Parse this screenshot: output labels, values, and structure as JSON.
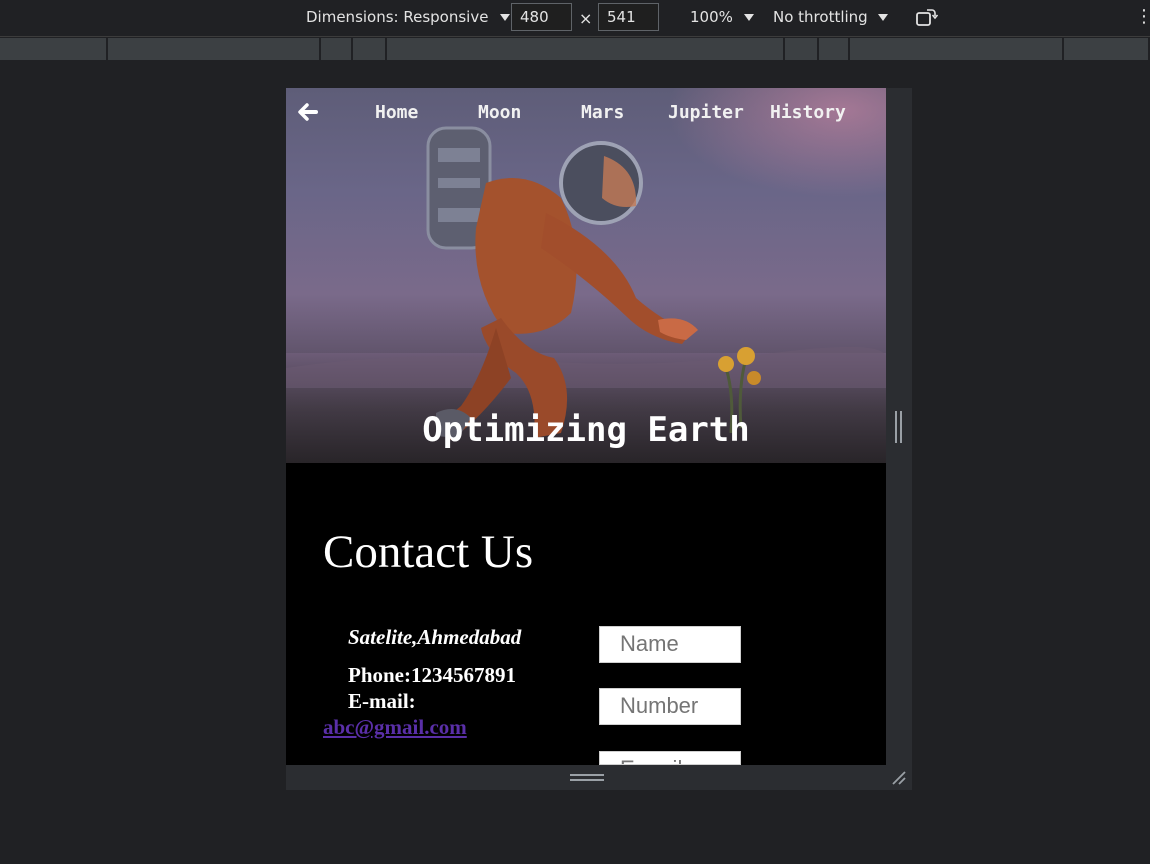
{
  "devtools": {
    "dimensions_label": "Dimensions: Responsive",
    "width_value": "480",
    "height_value": "541",
    "times": "×",
    "zoom": "100%",
    "throttling": "No throttling",
    "more": "⋮"
  },
  "nav": {
    "links": [
      "Home",
      "Moon",
      "Mars",
      "Jupiter",
      "History"
    ]
  },
  "hero": {
    "title": "Optimizing Earth"
  },
  "contact": {
    "heading": "Contact Us",
    "address": "Satelite,Ahmedabad",
    "phone": "Phone:1234567891",
    "email_label": "E-mail:",
    "email_link": "abc@gmail.com",
    "fields": {
      "name_placeholder": "Name",
      "number_placeholder": "Number",
      "email_placeholder": "E-mail"
    }
  },
  "colors": {
    "page_bg": "#202124",
    "contact_bg": "#000000",
    "link": "#5a2fa8"
  }
}
